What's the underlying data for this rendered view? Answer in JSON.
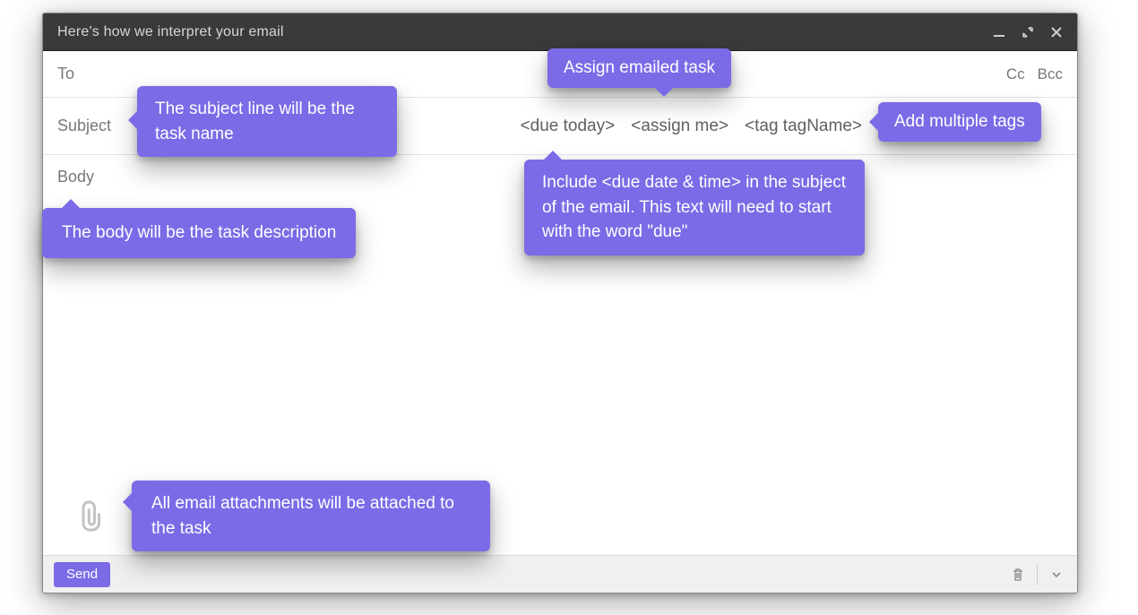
{
  "window": {
    "title": "Here's how we interpret your email"
  },
  "fields": {
    "to_label": "To",
    "cc_label": "Cc",
    "bcc_label": "Bcc",
    "subject_label": "Subject",
    "body_label": "Body"
  },
  "subject_tokens": {
    "due": "<due today>",
    "assign": "<assign me>",
    "tag": "<tag tagName>"
  },
  "callouts": {
    "subject": "The subject line will be the task name",
    "assign": "Assign emailed task",
    "tags": "Add multiple tags",
    "body": "The body will be the task description",
    "due": "Include <due date & time> in the subject of the email. This text will need to start with the word \"due\"",
    "attach": "All email attachments will be attached to the task"
  },
  "actions": {
    "send": "Send"
  },
  "colors": {
    "accent": "#7b6be6",
    "titlebar": "#3a3a3a"
  }
}
